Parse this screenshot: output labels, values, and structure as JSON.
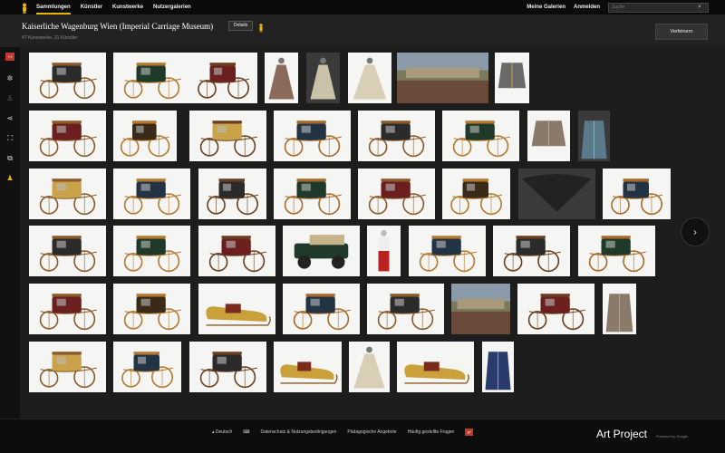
{
  "topbar": {
    "nav": [
      "Sammlungen",
      "Künstler",
      "Kunstwerke",
      "Nutzergalerien"
    ],
    "right_nav": [
      "Meine Galerien",
      "Anmelden"
    ],
    "search_placeholder": "Suche",
    "accent": "#e8b500"
  },
  "header": {
    "title": "Kaiserliche Wagenburg Wien (Imperial Carriage Museum)",
    "details_label": "Details",
    "subtitle": "47 Kunstwerke, 21 Künstler",
    "refine_label": "Verfeinern"
  },
  "sidebar": {
    "icons": [
      "google-plus-icon",
      "compass-icon",
      "pegman-icon",
      "share-icon",
      "fullscreen-icon",
      "compare-icon",
      "street-view-icon"
    ],
    "gplus_label": "+1"
  },
  "thumbnails": [
    [
      "carriage",
      "carriage",
      "carriage",
      "dress",
      "dress",
      "dress",
      "painting",
      "jacket"
    ],
    [
      "carriage",
      "carriage",
      "carriage",
      "carriage",
      "carriage",
      "carriage",
      "jacket",
      "coat"
    ],
    [
      "carriage",
      "carriage",
      "carriage",
      "carriage",
      "carriage",
      "carriage",
      "fan",
      "carriage"
    ],
    [
      "carriage",
      "carriage",
      "carriage",
      "car",
      "figure",
      "carriage",
      "carriage",
      "carriage"
    ],
    [
      "carriage",
      "carriage",
      "sleigh",
      "carriage",
      "carriage",
      "painting",
      "carriage",
      "coat"
    ],
    [
      "carriage",
      "carriage",
      "carriage",
      "sleigh",
      "dress",
      "sleigh",
      "coat"
    ]
  ],
  "next_label": "›",
  "footer": {
    "language": "Deutsch",
    "links": [
      "Datenschutz & Nutzungsbedingungen",
      "Pädagogische Angebote",
      "Häufig gestellte Fragen"
    ],
    "gplus": "g+",
    "brand": "Art Project",
    "brand_sub": "Powered by Google"
  }
}
